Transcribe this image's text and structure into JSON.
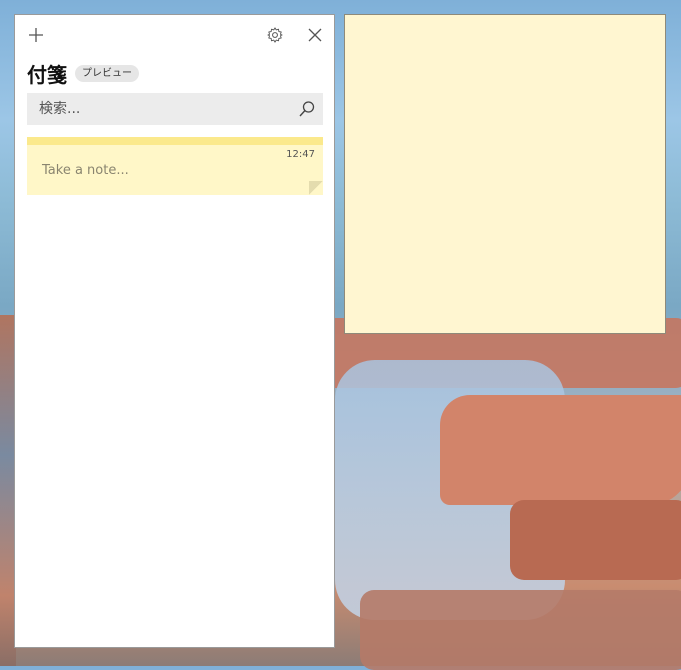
{
  "app": {
    "title": "付箋",
    "badge": "プレビュー"
  },
  "toolbar": {
    "add_icon": "plus-icon",
    "settings_icon": "gear-icon",
    "close_icon": "close-icon"
  },
  "search": {
    "placeholder": "検索...",
    "value": "",
    "icon": "search-icon"
  },
  "notes": [
    {
      "time": "12:47",
      "text": "Take a note...",
      "color": "#fff7c8",
      "accent": "#fbe98c"
    }
  ],
  "sticky": {
    "background": "#fff6d1"
  }
}
